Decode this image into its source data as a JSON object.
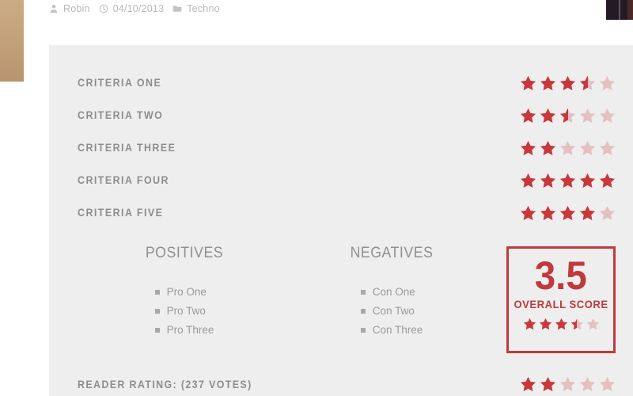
{
  "colors": {
    "star_filled": "#c8373a",
    "star_empty": "#e5c0c1",
    "accent": "#c0393c",
    "panel_bg": "#eeeeee",
    "page_bg": "#ffffff",
    "label_text": "#8d8d8d",
    "meta_text": "#b9b9b9",
    "left_bar": "#c2a079",
    "thumb": "#241a26"
  },
  "meta": {
    "author": {
      "icon": "user-icon",
      "text": "Robin"
    },
    "date": {
      "icon": "clock-icon",
      "text": "04/10/2013"
    },
    "category": {
      "icon": "folder-icon",
      "text": "Techno"
    }
  },
  "criteria": [
    {
      "label": "CRITERIA ONE",
      "rating": 3.5,
      "max": 5
    },
    {
      "label": "CRITERIA TWO",
      "rating": 2.5,
      "max": 5
    },
    {
      "label": "CRITERIA THREE",
      "rating": 2,
      "max": 5
    },
    {
      "label": "CRITERIA FOUR",
      "rating": 5,
      "max": 5
    },
    {
      "label": "CRITERIA FIVE",
      "rating": 4,
      "max": 5
    }
  ],
  "positives": {
    "title": "POSITIVES",
    "items": [
      "Pro One",
      "Pro Two",
      "Pro Three"
    ]
  },
  "negatives": {
    "title": "NEGATIVES",
    "items": [
      "Con One",
      "Con Two",
      "Con Three"
    ]
  },
  "overall": {
    "value": "3.5",
    "label": "OVERALL SCORE",
    "rating": 3.5,
    "max": 5
  },
  "reader_rating": {
    "label": "READER RATING: (237 VOTES)",
    "votes": 237,
    "rating": 2,
    "max": 5
  }
}
